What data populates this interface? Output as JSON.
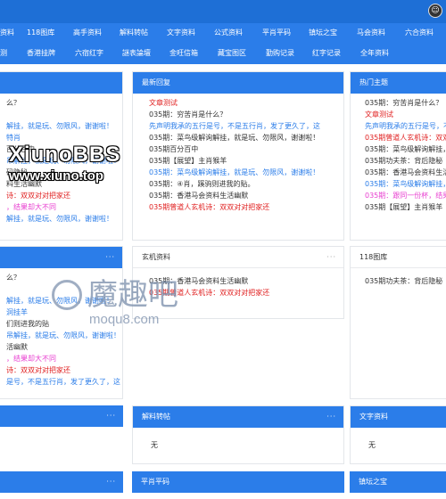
{
  "topbar": {
    "avatar_icon": "user-avatar-icon"
  },
  "nav": {
    "row1": [
      "资料",
      "118图库",
      "高手资料",
      "解料转帖",
      "文字资料",
      "公式资料",
      "平肖平码",
      "镇坛之宝",
      "马会资料",
      "六合资料"
    ],
    "row2": [
      "测",
      "香港挂牌",
      "六宿红字",
      "謎表論壇",
      "金旺信箱",
      "藏宝图区",
      "勤购记录",
      "红字记录",
      "全年资料"
    ]
  },
  "panels": {
    "left_top": {
      "title": "",
      "lines": [
        {
          "t": "么？",
          "c": "c-dark"
        },
        {
          "t": "",
          "c": "c-dark"
        },
        {
          "t": "解挂，就是玩、勿限风，谢谢啦！",
          "c": "c-blue"
        },
        {
          "t": "特肖",
          "c": "c-blue"
        },
        {
          "t": "百分百中",
          "c": "c-dark"
        },
        {
          "t": "吊解挂，就是玩、勿限风，谢谢啦！",
          "c": "c-blue"
        },
        {
          "t": "码隐秘",
          "c": "c-dark"
        },
        {
          "t": "料生活幽默",
          "c": "c-dark"
        },
        {
          "t": "诗：双双对对把家还",
          "c": "c-red"
        },
        {
          "t": "，结果却大不同",
          "c": "c-pink"
        },
        {
          "t": "解挂，就是玩、勿限风，谢谢啦！",
          "c": "c-blue"
        }
      ]
    },
    "latest": {
      "title": "最新回复",
      "lines": [
        {
          "t": "文章测试",
          "c": "c-red"
        },
        {
          "t": "035期：穷苦肖是什么？",
          "c": "c-dark"
        },
        {
          "t": "先声明我承的五行是号，不是五行肖，发了更久了，这",
          "c": "c-blue"
        },
        {
          "t": "035期：菜鸟级解询解挂，就是玩、勿限风，谢谢啦！",
          "c": "c-dark"
        },
        {
          "t": "035期百分百中",
          "c": "c-dark"
        },
        {
          "t": "035期【展望】主肖猴羊",
          "c": "c-dark"
        },
        {
          "t": "035期：菜鸟级解询解挂，就是玩、勿限风，谢谢啦！",
          "c": "c-blue"
        },
        {
          "t": "035期：④肖，蹊驹则进我的贴。",
          "c": "c-dark"
        },
        {
          "t": "035期：香港马会资料生活幽默",
          "c": "c-dark"
        },
        {
          "t": "035期曾道人玄机诗：双双对对把家还",
          "c": "c-red"
        }
      ]
    },
    "hot": {
      "title": "热门主题",
      "lines": [
        {
          "t": "035期：穷苦肖是什么？",
          "c": "c-dark"
        },
        {
          "t": "文章测试",
          "c": "c-red"
        },
        {
          "t": "先声明我承的五行是号，不是五行",
          "c": "c-blue"
        },
        {
          "t": "035期曾道人玄机诗：双双对对把",
          "c": "c-red"
        },
        {
          "t": "035期：菜鸟级解询解挂，就是玩",
          "c": "c-dark"
        },
        {
          "t": "035期功夫茶：背后隐秘",
          "c": "c-dark"
        },
        {
          "t": "035期：香港马会资料生活幽默",
          "c": "c-dark"
        },
        {
          "t": "035期：菜鸟级解询解挂，就是玩",
          "c": "c-blue"
        },
        {
          "t": "035期：跟同一份杯，结果却大不同",
          "c": "c-pink"
        },
        {
          "t": "035期【展望】主肖猴羊",
          "c": "c-dark"
        }
      ]
    },
    "left_mid": {
      "title": "",
      "lines": [
        {
          "t": "么？",
          "c": "c-dark"
        },
        {
          "t": "",
          "c": "c-dark"
        },
        {
          "t": "解挂，就是玩、勿限风，谢谢啦！",
          "c": "c-blue"
        },
        {
          "t": "洞挂羊",
          "c": "c-blue"
        },
        {
          "t": "们则进我的贴",
          "c": "c-dark"
        },
        {
          "t": "吊解挂，就是玩、勿限风，谢谢啦！",
          "c": "c-blue"
        },
        {
          "t": "活幽默",
          "c": "c-dark"
        },
        {
          "t": "，结果却大不同",
          "c": "c-pink"
        },
        {
          "t": "诗：双双对对把家还",
          "c": "c-red"
        },
        {
          "t": "是号，不是五行肖，发了更久了，这",
          "c": "c-blue"
        }
      ]
    },
    "xuanji": {
      "title": "玄机资料",
      "lines": [
        {
          "t": "035期：香港马会资料生活幽默",
          "c": "c-dark"
        },
        {
          "t": "035期曾道人玄机诗：双双对对把家还",
          "c": "c-red"
        }
      ]
    },
    "tuku": {
      "title": "118图库",
      "lines": [
        {
          "t": "035期功夫茶：背后隐秘",
          "c": "c-dark"
        }
      ]
    },
    "jieliao": {
      "title": "解料转帖",
      "empty": "无"
    },
    "wenzi": {
      "title": "文字资料",
      "empty": "无"
    },
    "pingxiao": {
      "title": "平肖平码"
    },
    "zhentan": {
      "title": "镇坛之宝"
    }
  },
  "watermarks": {
    "xiuno_big": "XiunoBBS",
    "xiuno_small": "www.xiuno.top",
    "moqu_big": "魔趣吧",
    "moqu_small": "moqu8.com"
  }
}
